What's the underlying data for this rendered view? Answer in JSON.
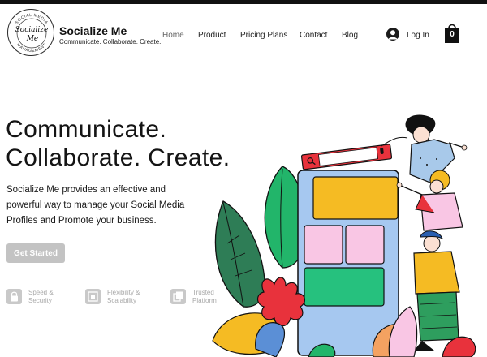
{
  "brand": {
    "name": "Socialize Me",
    "tagline": "Communicate. Collaborate. Create.",
    "logo_script": "Socialize Me",
    "logo_ring_top": "SOCIAL MEDIA",
    "logo_ring_bottom": "MANAGEMENT"
  },
  "nav": {
    "items": [
      {
        "label": "Home",
        "active": true
      },
      {
        "label": "Product"
      },
      {
        "label": "Pricing Plans"
      },
      {
        "label": "Contact"
      },
      {
        "label": "Blog"
      }
    ]
  },
  "account": {
    "login_label": "Log In",
    "avatar_icon": "user-avatar-icon"
  },
  "cart": {
    "count": "0",
    "icon": "shopping-bag-icon"
  },
  "hero": {
    "title_line1": "Communicate.",
    "title_line2": "Collaborate. Create.",
    "description": "Socialize Me provides an effective and powerful way to manage your Social Media Profiles and Promote your business.",
    "cta_label": "Get Started"
  },
  "features": [
    {
      "line1": "Speed &",
      "line2": "Security",
      "icon": "lock-icon"
    },
    {
      "line1": "Flexibility &",
      "line2": "Scalability",
      "icon": "expand-icon"
    },
    {
      "line1": "Trusted",
      "line2": "Platform",
      "icon": "copy-icon"
    }
  ],
  "colors": {
    "text": "#1c1c1c",
    "cta_bg": "#c3c3c3",
    "muted": "#a9a9a9",
    "search_red": "#e8323c",
    "phone_blue": "#a6c8f0",
    "tile_yellow": "#f5bb23",
    "tile_pink": "#f9c6e4",
    "tile_green": "#26c17e",
    "leaf_green": "#2e8b57"
  }
}
